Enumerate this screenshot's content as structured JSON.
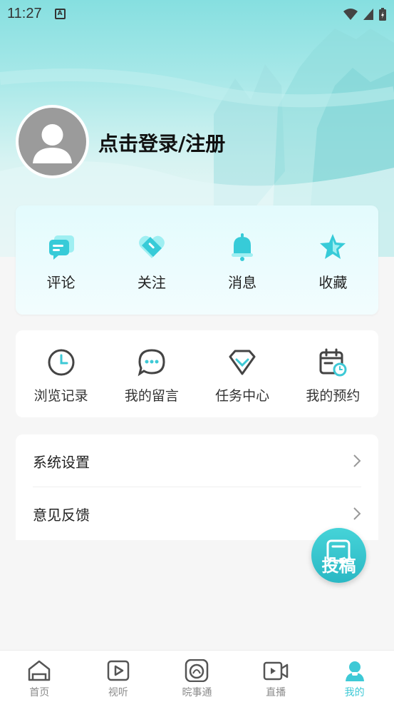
{
  "status": {
    "time": "11:27",
    "notification_icon": "A"
  },
  "profile": {
    "login_text": "点击登录/注册"
  },
  "quick_actions": [
    {
      "label": "评论",
      "icon": "comment-icon"
    },
    {
      "label": "关注",
      "icon": "follow-icon"
    },
    {
      "label": "消息",
      "icon": "bell-icon"
    },
    {
      "label": "收藏",
      "icon": "star-icon"
    }
  ],
  "services": [
    {
      "label": "浏览记录",
      "icon": "clock-icon"
    },
    {
      "label": "我的留言",
      "icon": "chat-icon"
    },
    {
      "label": "任务中心",
      "icon": "diamond-icon"
    },
    {
      "label": "我的预约",
      "icon": "calendar-icon"
    }
  ],
  "settings": [
    {
      "label": "系统设置"
    },
    {
      "label": "意见反馈"
    }
  ],
  "fab": {
    "label": "投稿"
  },
  "tabs": [
    {
      "label": "首页",
      "icon": "home-icon"
    },
    {
      "label": "视听",
      "icon": "play-icon"
    },
    {
      "label": "晥事通",
      "icon": "service-icon"
    },
    {
      "label": "直播",
      "icon": "live-icon"
    },
    {
      "label": "我的",
      "icon": "user-icon",
      "active": true
    }
  ],
  "colors": {
    "accent": "#3ec9d6",
    "card_bg": "#e3fbfd"
  }
}
